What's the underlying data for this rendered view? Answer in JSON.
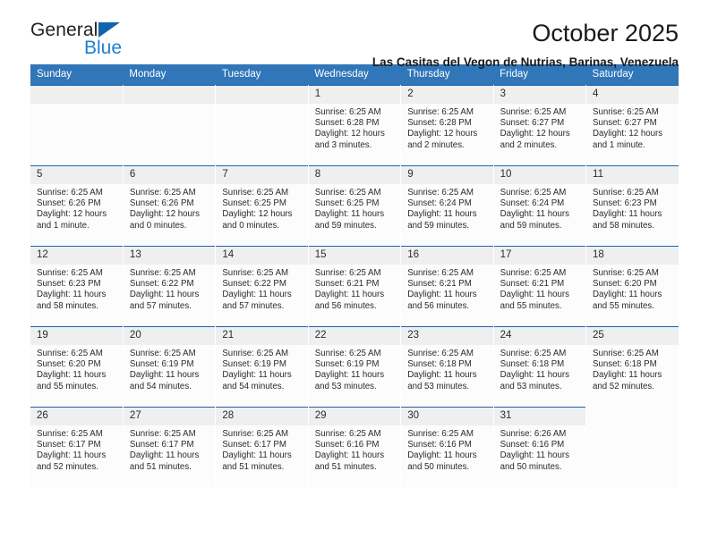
{
  "brand": {
    "name_top": "General",
    "name_bottom": "Blue",
    "triangle_color": "#1263ad",
    "blue_text_color": "#1f7fd0"
  },
  "header": {
    "title": "October 2025",
    "subtitle": "Las Casitas del Vegon de Nutrias, Barinas, Venezuela"
  },
  "colors": {
    "header_row_bg": "#3076b8",
    "daynum_bg": "#efefef",
    "cell_top_rule": "#1a66ad",
    "cell_bg": "#fcfcfc"
  },
  "weekdays": [
    "Sunday",
    "Monday",
    "Tuesday",
    "Wednesday",
    "Thursday",
    "Friday",
    "Saturday"
  ],
  "labels": {
    "sunrise_prefix": "Sunrise:",
    "sunset_prefix": "Sunset:",
    "daylight_prefix": "Daylight:"
  },
  "weeks": [
    [
      {
        "day": "",
        "empty": true
      },
      {
        "day": "",
        "empty": true
      },
      {
        "day": "",
        "empty": true
      },
      {
        "day": "1",
        "sunrise": "Sunrise: 6:25 AM",
        "sunset": "Sunset: 6:28 PM",
        "daylight": "Daylight: 12 hours and 3 minutes."
      },
      {
        "day": "2",
        "sunrise": "Sunrise: 6:25 AM",
        "sunset": "Sunset: 6:28 PM",
        "daylight": "Daylight: 12 hours and 2 minutes."
      },
      {
        "day": "3",
        "sunrise": "Sunrise: 6:25 AM",
        "sunset": "Sunset: 6:27 PM",
        "daylight": "Daylight: 12 hours and 2 minutes."
      },
      {
        "day": "4",
        "sunrise": "Sunrise: 6:25 AM",
        "sunset": "Sunset: 6:27 PM",
        "daylight": "Daylight: 12 hours and 1 minute."
      }
    ],
    [
      {
        "day": "5",
        "sunrise": "Sunrise: 6:25 AM",
        "sunset": "Sunset: 6:26 PM",
        "daylight": "Daylight: 12 hours and 1 minute."
      },
      {
        "day": "6",
        "sunrise": "Sunrise: 6:25 AM",
        "sunset": "Sunset: 6:26 PM",
        "daylight": "Daylight: 12 hours and 0 minutes."
      },
      {
        "day": "7",
        "sunrise": "Sunrise: 6:25 AM",
        "sunset": "Sunset: 6:25 PM",
        "daylight": "Daylight: 12 hours and 0 minutes."
      },
      {
        "day": "8",
        "sunrise": "Sunrise: 6:25 AM",
        "sunset": "Sunset: 6:25 PM",
        "daylight": "Daylight: 11 hours and 59 minutes."
      },
      {
        "day": "9",
        "sunrise": "Sunrise: 6:25 AM",
        "sunset": "Sunset: 6:24 PM",
        "daylight": "Daylight: 11 hours and 59 minutes."
      },
      {
        "day": "10",
        "sunrise": "Sunrise: 6:25 AM",
        "sunset": "Sunset: 6:24 PM",
        "daylight": "Daylight: 11 hours and 59 minutes."
      },
      {
        "day": "11",
        "sunrise": "Sunrise: 6:25 AM",
        "sunset": "Sunset: 6:23 PM",
        "daylight": "Daylight: 11 hours and 58 minutes."
      }
    ],
    [
      {
        "day": "12",
        "sunrise": "Sunrise: 6:25 AM",
        "sunset": "Sunset: 6:23 PM",
        "daylight": "Daylight: 11 hours and 58 minutes."
      },
      {
        "day": "13",
        "sunrise": "Sunrise: 6:25 AM",
        "sunset": "Sunset: 6:22 PM",
        "daylight": "Daylight: 11 hours and 57 minutes."
      },
      {
        "day": "14",
        "sunrise": "Sunrise: 6:25 AM",
        "sunset": "Sunset: 6:22 PM",
        "daylight": "Daylight: 11 hours and 57 minutes."
      },
      {
        "day": "15",
        "sunrise": "Sunrise: 6:25 AM",
        "sunset": "Sunset: 6:21 PM",
        "daylight": "Daylight: 11 hours and 56 minutes."
      },
      {
        "day": "16",
        "sunrise": "Sunrise: 6:25 AM",
        "sunset": "Sunset: 6:21 PM",
        "daylight": "Daylight: 11 hours and 56 minutes."
      },
      {
        "day": "17",
        "sunrise": "Sunrise: 6:25 AM",
        "sunset": "Sunset: 6:21 PM",
        "daylight": "Daylight: 11 hours and 55 minutes."
      },
      {
        "day": "18",
        "sunrise": "Sunrise: 6:25 AM",
        "sunset": "Sunset: 6:20 PM",
        "daylight": "Daylight: 11 hours and 55 minutes."
      }
    ],
    [
      {
        "day": "19",
        "sunrise": "Sunrise: 6:25 AM",
        "sunset": "Sunset: 6:20 PM",
        "daylight": "Daylight: 11 hours and 55 minutes."
      },
      {
        "day": "20",
        "sunrise": "Sunrise: 6:25 AM",
        "sunset": "Sunset: 6:19 PM",
        "daylight": "Daylight: 11 hours and 54 minutes."
      },
      {
        "day": "21",
        "sunrise": "Sunrise: 6:25 AM",
        "sunset": "Sunset: 6:19 PM",
        "daylight": "Daylight: 11 hours and 54 minutes."
      },
      {
        "day": "22",
        "sunrise": "Sunrise: 6:25 AM",
        "sunset": "Sunset: 6:19 PM",
        "daylight": "Daylight: 11 hours and 53 minutes."
      },
      {
        "day": "23",
        "sunrise": "Sunrise: 6:25 AM",
        "sunset": "Sunset: 6:18 PM",
        "daylight": "Daylight: 11 hours and 53 minutes."
      },
      {
        "day": "24",
        "sunrise": "Sunrise: 6:25 AM",
        "sunset": "Sunset: 6:18 PM",
        "daylight": "Daylight: 11 hours and 53 minutes."
      },
      {
        "day": "25",
        "sunrise": "Sunrise: 6:25 AM",
        "sunset": "Sunset: 6:18 PM",
        "daylight": "Daylight: 11 hours and 52 minutes."
      }
    ],
    [
      {
        "day": "26",
        "sunrise": "Sunrise: 6:25 AM",
        "sunset": "Sunset: 6:17 PM",
        "daylight": "Daylight: 11 hours and 52 minutes."
      },
      {
        "day": "27",
        "sunrise": "Sunrise: 6:25 AM",
        "sunset": "Sunset: 6:17 PM",
        "daylight": "Daylight: 11 hours and 51 minutes."
      },
      {
        "day": "28",
        "sunrise": "Sunrise: 6:25 AM",
        "sunset": "Sunset: 6:17 PM",
        "daylight": "Daylight: 11 hours and 51 minutes."
      },
      {
        "day": "29",
        "sunrise": "Sunrise: 6:25 AM",
        "sunset": "Sunset: 6:16 PM",
        "daylight": "Daylight: 11 hours and 51 minutes."
      },
      {
        "day": "30",
        "sunrise": "Sunrise: 6:25 AM",
        "sunset": "Sunset: 6:16 PM",
        "daylight": "Daylight: 11 hours and 50 minutes."
      },
      {
        "day": "31",
        "sunrise": "Sunrise: 6:26 AM",
        "sunset": "Sunset: 6:16 PM",
        "daylight": "Daylight: 11 hours and 50 minutes."
      },
      {
        "day": "",
        "empty": true,
        "no_band": true
      }
    ]
  ]
}
